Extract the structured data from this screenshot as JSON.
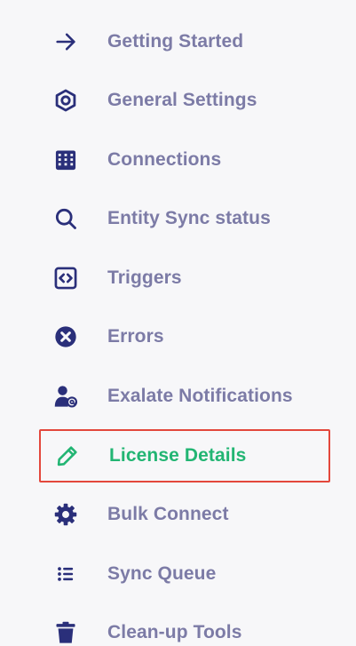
{
  "sidebar": {
    "colors": {
      "icon": "#2a2f7a",
      "label": "#7c7ba6",
      "active": "#22b573",
      "highlight_border": "#e3473c"
    },
    "items": [
      {
        "label": "Getting Started",
        "icon": "arrow-right-icon"
      },
      {
        "label": "General Settings",
        "icon": "hexagon-settings-icon"
      },
      {
        "label": "Connections",
        "icon": "building-icon"
      },
      {
        "label": "Entity Sync status",
        "icon": "search-icon"
      },
      {
        "label": "Triggers",
        "icon": "code-icon"
      },
      {
        "label": "Errors",
        "icon": "error-circle-icon"
      },
      {
        "label": "Exalate Notifications",
        "icon": "user-at-icon"
      },
      {
        "label": "License Details",
        "icon": "pencil-icon",
        "active": true
      },
      {
        "label": "Bulk Connect",
        "icon": "gear-icon"
      },
      {
        "label": "Sync Queue",
        "icon": "list-icon"
      },
      {
        "label": "Clean-up Tools",
        "icon": "trash-icon"
      }
    ]
  }
}
